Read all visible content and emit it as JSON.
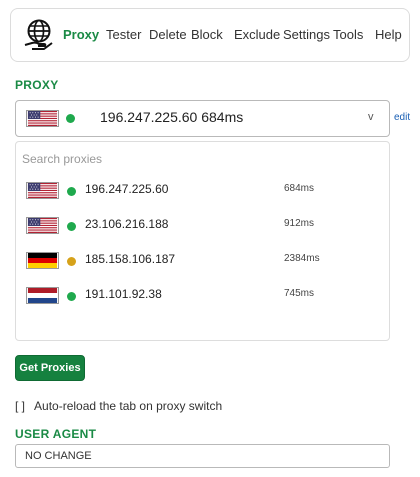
{
  "nav": {
    "logo_icon": "globe-hand-icon",
    "items": [
      {
        "label": "Proxy",
        "active": true
      },
      {
        "label": "Tester"
      },
      {
        "label": "Delete"
      },
      {
        "label": "Block"
      },
      {
        "label": "Exclude"
      },
      {
        "label": "Settings"
      },
      {
        "label": "Tools"
      },
      {
        "label": "Help"
      }
    ]
  },
  "proxy_section": {
    "title": "PROXY",
    "selected": {
      "flag": "us",
      "status": "green",
      "ip": "196.247.225.60",
      "latency": "684ms",
      "text": "196.247.225.60  684ms"
    },
    "chevron": "v",
    "edit_label": "edit"
  },
  "dropdown": {
    "search_placeholder": "Search proxies",
    "items": [
      {
        "flag": "us",
        "status": "green",
        "ip": "196.247.225.60",
        "latency": "684ms"
      },
      {
        "flag": "us",
        "status": "green",
        "ip": "23.106.216.188",
        "latency": "912ms"
      },
      {
        "flag": "de",
        "status": "amber",
        "ip": "185.158.106.187",
        "latency": "2384ms"
      },
      {
        "flag": "nl",
        "status": "green",
        "ip": "191.101.92.38",
        "latency": "745ms"
      }
    ]
  },
  "get_proxies_label": "Get Proxies",
  "auto_reload": {
    "checkbox": "[ ]",
    "label": "Auto-reload the tab on proxy switch",
    "checked": false
  },
  "user_agent": {
    "title": "USER AGENT",
    "value": "NO CHANGE"
  },
  "colors": {
    "accent": "#1a8a45",
    "button": "#15813f",
    "status_green": "#1fa94d",
    "status_amber": "#d6a21a",
    "link": "#1a5fb4"
  }
}
